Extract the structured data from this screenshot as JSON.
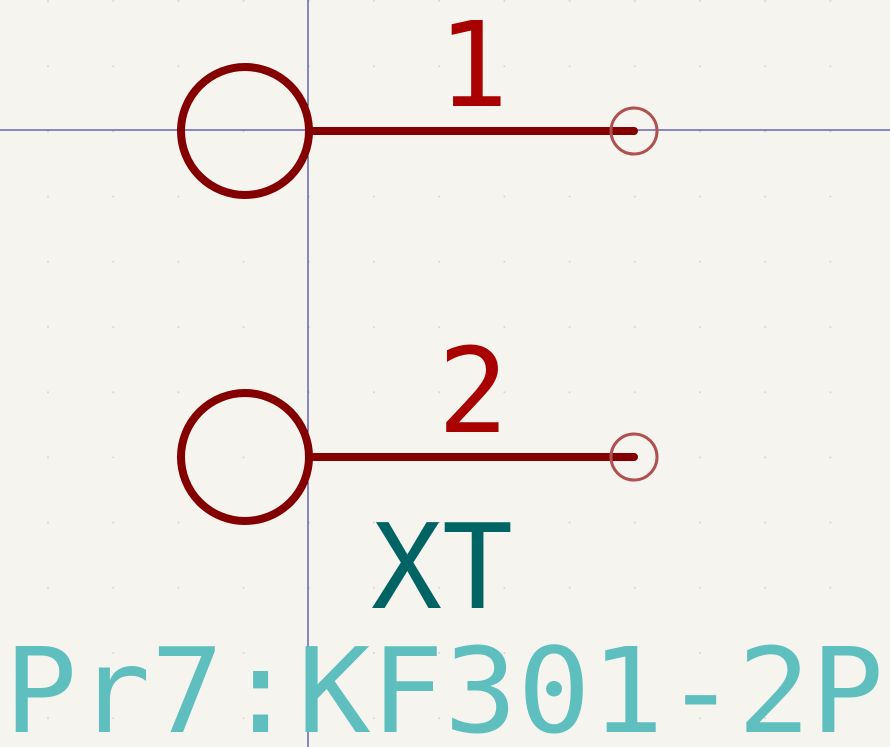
{
  "symbol": {
    "reference": "XT",
    "value": "Pr7:KF301-2P",
    "pins": [
      {
        "number": "1"
      },
      {
        "number": "2"
      }
    ]
  },
  "colors": {
    "background": "#f5f4ef",
    "body": "#840000",
    "pin_number": "#a90000",
    "pin_end": "#b05050",
    "reference": "#006464",
    "value": "#5fbfbf",
    "crosshair": "#1a1a8c",
    "grid_dot": "#d8d8d0"
  }
}
